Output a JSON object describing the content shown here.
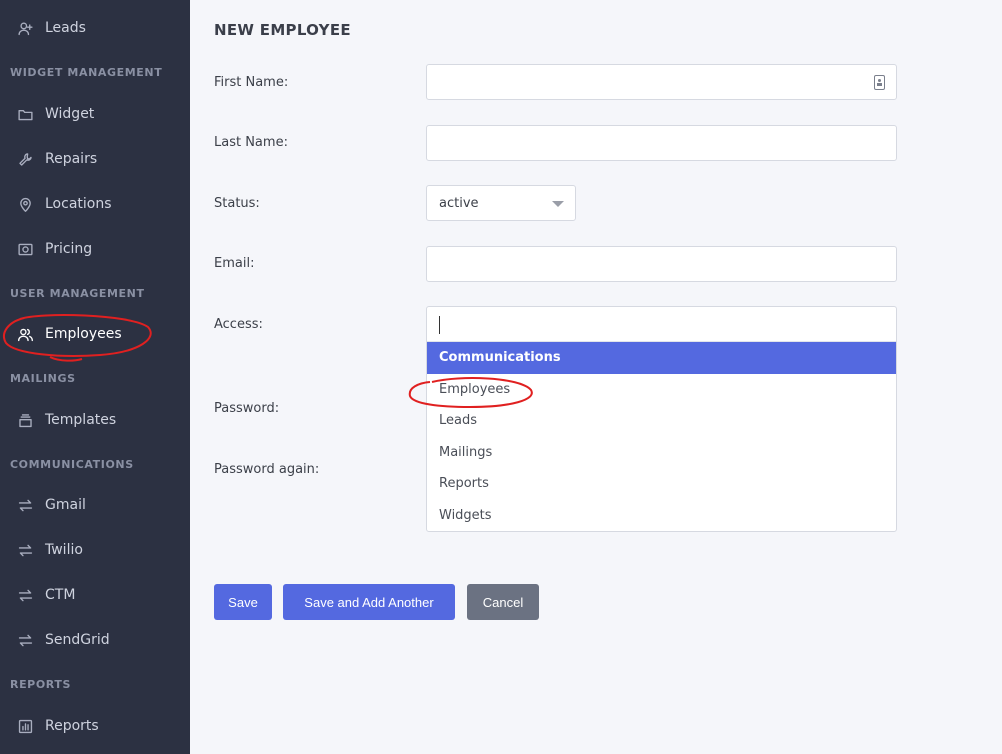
{
  "sidebar": {
    "items": [
      {
        "label": "Leads",
        "icon": "user-plus-icon"
      },
      {
        "label": "Widget",
        "icon": "folder-icon"
      },
      {
        "label": "Repairs",
        "icon": "wrench-icon"
      },
      {
        "label": "Locations",
        "icon": "map-pin-icon"
      },
      {
        "label": "Pricing",
        "icon": "camera-icon"
      },
      {
        "label": "Employees",
        "icon": "users-icon"
      },
      {
        "label": "Templates",
        "icon": "archive-icon"
      },
      {
        "label": "Gmail",
        "icon": "arrows-swap-icon"
      },
      {
        "label": "Twilio",
        "icon": "arrows-swap-icon"
      },
      {
        "label": "CTM",
        "icon": "arrows-swap-icon"
      },
      {
        "label": "SendGrid",
        "icon": "arrows-swap-icon"
      },
      {
        "label": "Reports",
        "icon": "bar-chart-icon"
      }
    ],
    "sections": {
      "widget_management": "WIDGET MANAGEMENT",
      "user_management": "USER MANAGEMENT",
      "mailings": "MAILINGS",
      "communications": "COMMUNICATIONS",
      "reports": "REPORTS"
    },
    "active_item": "Employees"
  },
  "form": {
    "title": "NEW EMPLOYEE",
    "first_name_label": "First Name:",
    "first_name_value": "",
    "last_name_label": "Last Name:",
    "last_name_value": "",
    "status_label": "Status:",
    "status_value": "active",
    "email_label": "Email:",
    "email_value": "",
    "access_label": "Access:",
    "password_label": "Password:",
    "password_again_label": "Password again:"
  },
  "access_dropdown": {
    "options": [
      "Communications",
      "Employees",
      "Leads",
      "Mailings",
      "Reports",
      "Widgets"
    ],
    "highlighted": "Communications"
  },
  "buttons": {
    "save": "Save",
    "save_and_add": "Save and Add Another",
    "cancel": "Cancel"
  },
  "colors": {
    "sidebar_bg": "#2c3142",
    "accent": "#5469e0",
    "cancel": "#6b7282",
    "annotation": "#e02020"
  }
}
